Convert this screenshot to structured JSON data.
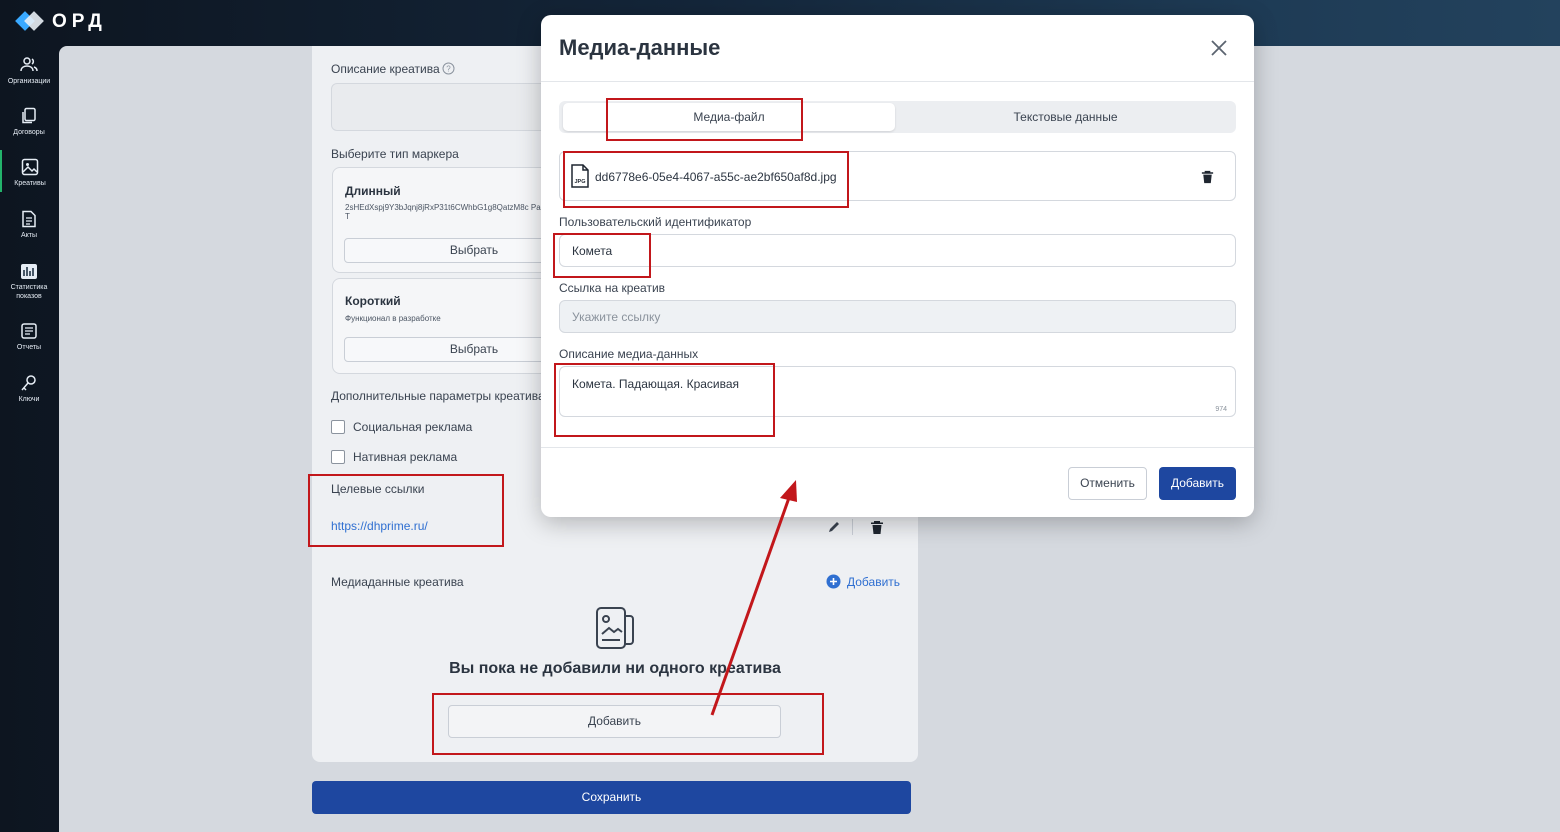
{
  "app": {
    "logo_text": "ОРД"
  },
  "sidebar": {
    "items": [
      {
        "label": "Организации",
        "icon": "users-icon"
      },
      {
        "label": "Договоры",
        "icon": "documents-icon"
      },
      {
        "label": "Креативы",
        "icon": "image-icon",
        "active": true
      },
      {
        "label": "Акты",
        "icon": "file-icon"
      },
      {
        "label": "Статистика показов",
        "icon": "stats-icon"
      },
      {
        "label": "Отчеты",
        "icon": "report-icon"
      },
      {
        "label": "Ключи",
        "icon": "key-icon"
      }
    ]
  },
  "form": {
    "creative_description_label": "Описание креатива",
    "marker_type_label": "Выберите тип маркера",
    "marker_long": {
      "title": "Длинный",
      "code": "2sHEdXspj9Y3bJqnj8jRxP31t6CWhbG1g8QatzM8c PaT",
      "button": "Выбрать"
    },
    "marker_short": {
      "title": "Короткий",
      "subtitle": "Функционал в разработке",
      "button": "Выбрать"
    },
    "extra_params_label": "Дополнительные параметры креатива",
    "checkbox_social": "Социальная реклама",
    "checkbox_native": "Нативная реклама",
    "target_links_label": "Целевые ссылки",
    "target_link": "https://dhprime.ru/",
    "media_label": "Медиаданные креатива",
    "media_add_link": "Добавить",
    "empty_title": "Вы пока не добавили ни одного креатива",
    "empty_add_button": "Добавить",
    "save_button": "Сохранить"
  },
  "modal": {
    "title": "Медиа-данные",
    "tabs": [
      "Медиа-файл",
      "Текстовые данные"
    ],
    "active_tab": 0,
    "file_name": "dd6778e6-05e4-4067-a55c-ae2bf650af8d.jpg",
    "file_icon_label": "JPG",
    "user_id_label": "Пользовательский идентификатор",
    "user_id_value": "Комета",
    "link_label": "Ссылка на креатив",
    "link_placeholder": "Укажите ссылку",
    "description_label": "Описание медиа-данных",
    "description_value": "Комета. Падающая. Красивая",
    "description_counter": "974",
    "cancel_button": "Отменить",
    "add_button": "Добавить"
  },
  "colors": {
    "accent": "#1e47a0",
    "annotation": "#c2171b",
    "link": "#2f6fd1",
    "active_nav": "#23b36b"
  }
}
